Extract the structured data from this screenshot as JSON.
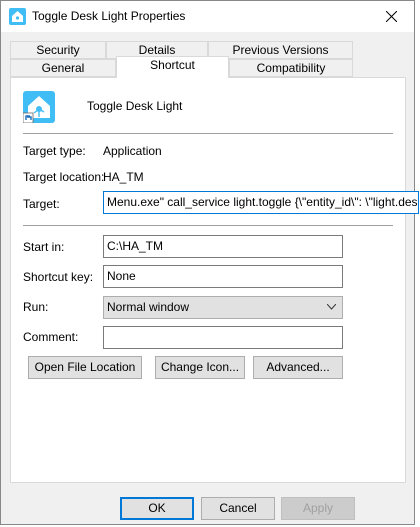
{
  "window": {
    "title": "Toggle Desk Light Properties",
    "icon": "home-assistant-icon",
    "close_icon": "close-icon"
  },
  "tabs": {
    "row1": [
      "Security",
      "Details",
      "Previous Versions"
    ],
    "row2": [
      "General",
      "Shortcut",
      "Compatibility"
    ],
    "active": "Shortcut"
  },
  "shortcut": {
    "name": "Toggle Desk Light",
    "target_type_label": "Target type:",
    "target_type": "Application",
    "target_location_label": "Target location:",
    "target_location": "HA_TM",
    "target_label": "Target:",
    "target_value": "Menu.exe\" call_service light.toggle {\\\"entity_id\\\": \\\"light.desk\\\"}",
    "start_in_label": "Start in:",
    "start_in_value": "C:\\HA_TM",
    "shortcut_key_label": "Shortcut key:",
    "shortcut_key_value": "None",
    "run_label": "Run:",
    "run_value": "Normal window",
    "comment_label": "Comment:",
    "comment_value": "",
    "open_file_location": "Open File Location",
    "change_icon": "Change Icon...",
    "advanced": "Advanced..."
  },
  "footer": {
    "ok": "OK",
    "cancel": "Cancel",
    "apply": "Apply"
  }
}
